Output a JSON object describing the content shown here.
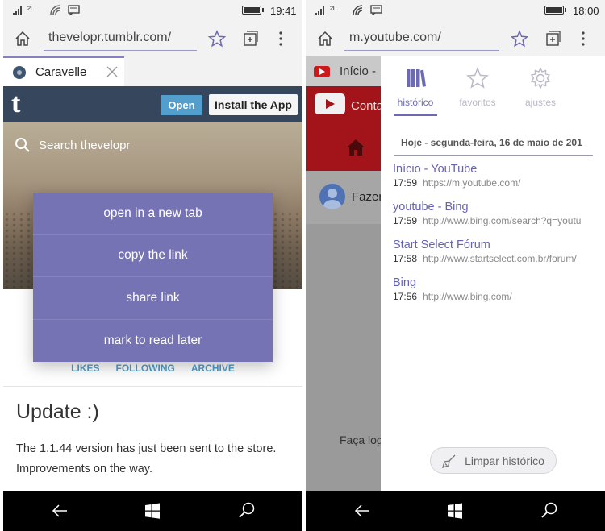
{
  "left_phone": {
    "status": {
      "time": "19:41"
    },
    "address": {
      "url": "thevelopr.tumblr.com/"
    },
    "tab": {
      "title": "Caravelle"
    },
    "tumblr": {
      "logo": "t",
      "open_label": "Open",
      "install_label": "Install the App",
      "search_placeholder": "Search thevelopr"
    },
    "context_menu": {
      "items": [
        {
          "label": "open in a new tab"
        },
        {
          "label": "copy the link"
        },
        {
          "label": "share link"
        },
        {
          "label": "mark to read later"
        }
      ]
    },
    "blog_links": {
      "likes": "LIKES",
      "following": "FOLLOWING",
      "archive": "ARCHIVE"
    },
    "post": {
      "title": "Update :)",
      "body": "The 1.1.44 version has just been sent to the store. Improvements on the way."
    }
  },
  "right_phone": {
    "status": {
      "time": "18:00"
    },
    "address": {
      "url": "m.youtube.com/"
    },
    "background_page": {
      "tab_title": "Início -",
      "conta_label": "Conta",
      "fazer_label": "Fazer",
      "faca_label": "Faça log"
    },
    "history_panel": {
      "tabs": [
        {
          "label": "histórico",
          "icon": "books-icon"
        },
        {
          "label": "favoritos",
          "icon": "star-icon"
        },
        {
          "label": "ajustes",
          "icon": "gear-icon"
        }
      ],
      "date_header": "Hoje - segunda-feira, 16 de maio de 201",
      "items": [
        {
          "title": "Início - YouTube",
          "time": "17:59",
          "url": "https://m.youtube.com/"
        },
        {
          "title": "youtube - Bing",
          "time": "17:59",
          "url": "http://www.bing.com/search?q=youtu"
        },
        {
          "title": "Start Select Fórum",
          "time": "17:58",
          "url": "http://www.startselect.com.br/forum/"
        },
        {
          "title": "Bing",
          "time": "17:56",
          "url": "http://www.bing.com/"
        }
      ],
      "clear_label": "Limpar histórico"
    }
  },
  "colors": {
    "accent": "#7673b4",
    "tumblr_navy": "#36465d",
    "youtube_red": "#a3141a",
    "link_blue": "#529ecc"
  }
}
